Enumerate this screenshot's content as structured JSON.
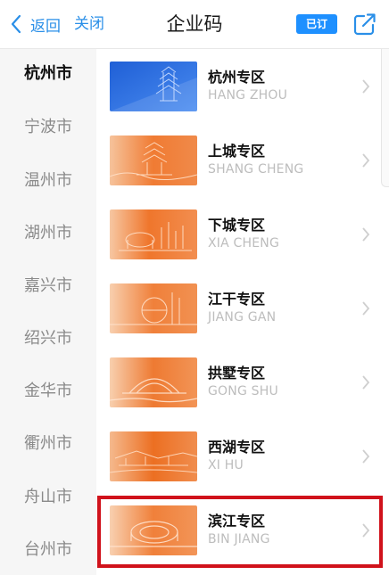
{
  "header": {
    "back_label": "返回",
    "close_label": "关闭",
    "title": "企业码",
    "subscribed_label": "已订"
  },
  "sidebar": {
    "cities": [
      {
        "label": "杭州市",
        "active": true
      },
      {
        "label": "宁波市",
        "active": false
      },
      {
        "label": "温州市",
        "active": false
      },
      {
        "label": "湖州市",
        "active": false
      },
      {
        "label": "嘉兴市",
        "active": false
      },
      {
        "label": "绍兴市",
        "active": false
      },
      {
        "label": "金华市",
        "active": false
      },
      {
        "label": "衢州市",
        "active": false
      },
      {
        "label": "舟山市",
        "active": false
      },
      {
        "label": "台州市",
        "active": false
      }
    ]
  },
  "zones": [
    {
      "name": "杭州专区",
      "pinyin": "HANG ZHOU",
      "theme": "blue"
    },
    {
      "name": "上城专区",
      "pinyin": "SHANG CHENG",
      "theme": "orange"
    },
    {
      "name": "下城专区",
      "pinyin": "XIA CHENG",
      "theme": "orange"
    },
    {
      "name": "江干专区",
      "pinyin": "JIANG GAN",
      "theme": "orange"
    },
    {
      "name": "拱墅专区",
      "pinyin": "GONG SHU",
      "theme": "orange"
    },
    {
      "name": "西湖专区",
      "pinyin": "XI HU",
      "theme": "orange"
    },
    {
      "name": "滨江专区",
      "pinyin": "BIN JIANG",
      "theme": "orange"
    }
  ],
  "colors": {
    "accent": "#2a8fe8",
    "badge": "#1e90ff",
    "highlight": "#d0121b",
    "thumb_blue": "#2f6fe0",
    "thumb_orange": "#f07a30"
  }
}
